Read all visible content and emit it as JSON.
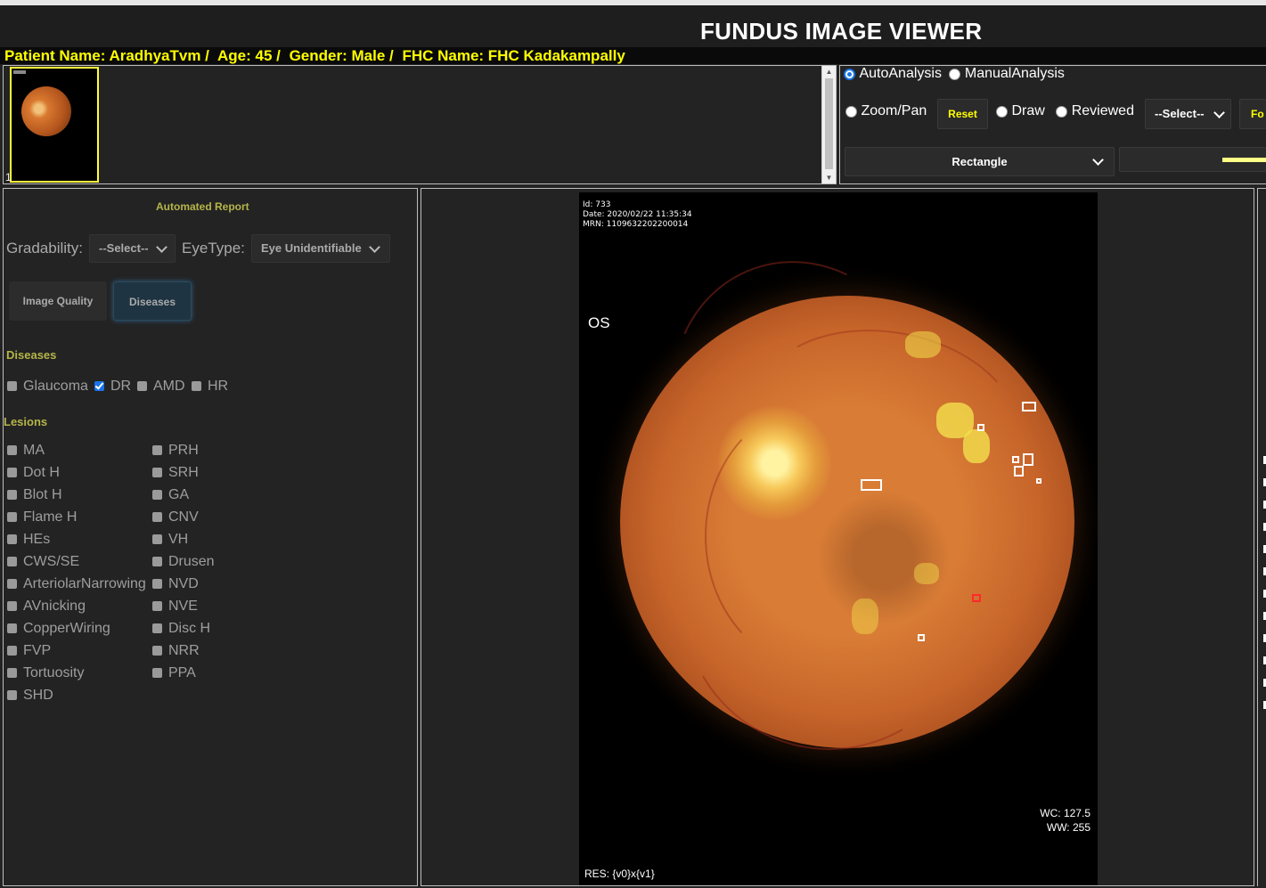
{
  "header": {
    "title": "FUNDUS IMAGE VIEWER"
  },
  "patient": {
    "name": "Patient Name: AradhyaTvm /",
    "age": "Age: 45 /",
    "gender": "Gender: Male /",
    "fhc": "FHC Name: FHC Kadakampally"
  },
  "thumbnails": {
    "index": "1"
  },
  "tools": {
    "analysis_modes": [
      "AutoAnalysis",
      "ManualAnalysis"
    ],
    "selected_mode": "AutoAnalysis",
    "zoom_pan": "Zoom/Pan",
    "reset": "Reset",
    "draw": "Draw",
    "reviewed": "Reviewed",
    "select_placeholder": "--Select--",
    "cut_button": "Fo",
    "shape": "Rectangle"
  },
  "report": {
    "title": "Automated Report",
    "gradability_label": "Gradability:",
    "gradability_value": "--Select--",
    "eyetype_label": "EyeType:",
    "eyetype_value": "Eye Unidentifiable",
    "tabs": [
      "Image Quality",
      "Diseases"
    ],
    "active_tab": "Diseases",
    "diseases_title": "Diseases",
    "diseases": [
      {
        "label": "Glaucoma",
        "checked": false
      },
      {
        "label": "DR",
        "checked": true
      },
      {
        "label": "AMD",
        "checked": false
      },
      {
        "label": "HR",
        "checked": false
      }
    ],
    "lesions_title": "Lesions",
    "lesions_left": [
      "MA",
      "Dot H",
      "Blot H",
      "Flame H",
      "HEs",
      "CWS/SE",
      "ArteriolarNarrowing",
      "AVnicking",
      "CopperWiring",
      "FVP",
      "Tortuosity",
      "SHD"
    ],
    "lesions_right": [
      "PRH",
      "SRH",
      "GA",
      "CNV",
      "VH",
      "Drusen",
      "NVD",
      "NVE",
      "Disc H",
      "NRR",
      "PPA"
    ]
  },
  "viewer": {
    "meta_id": "Id: 733",
    "meta_date": "Date: 2020/02/22 11:35:34",
    "meta_mrn": "MRN: 1109632202200014",
    "eye_side": "OS",
    "wc": "WC: 127.5",
    "ww": "WW: 255",
    "res": "RES: {v0}x{v1}"
  },
  "colors": {
    "accent_yellow": "#ffff00",
    "section_olive": "#b5b54a",
    "roi_white": "#ffffff",
    "roi_red": "#ff2a2a",
    "checkbox_blue": "#1a73e8"
  },
  "icons": [
    "chevron-down-icon",
    "radio-icon",
    "checkbox-icon"
  ]
}
